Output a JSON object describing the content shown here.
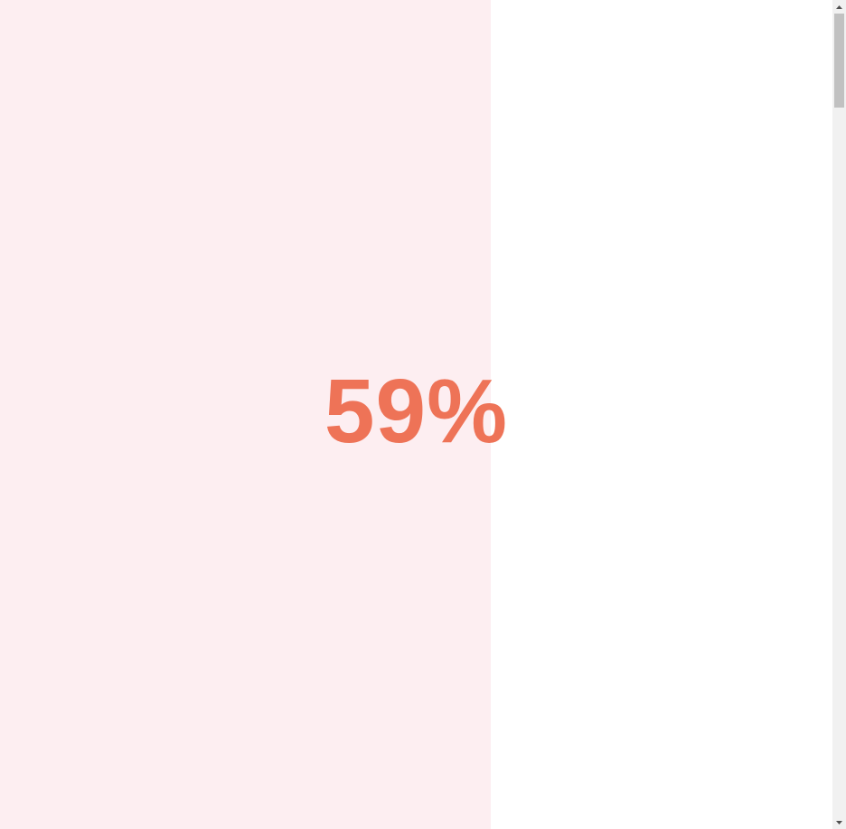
{
  "progress": {
    "label": "59%",
    "value": 0.59,
    "fill_color": "#fdeef1",
    "text_color": "#ee7357"
  },
  "scrollbar": {
    "up_icon": "triangle-up-icon",
    "down_icon": "triangle-down-icon"
  }
}
